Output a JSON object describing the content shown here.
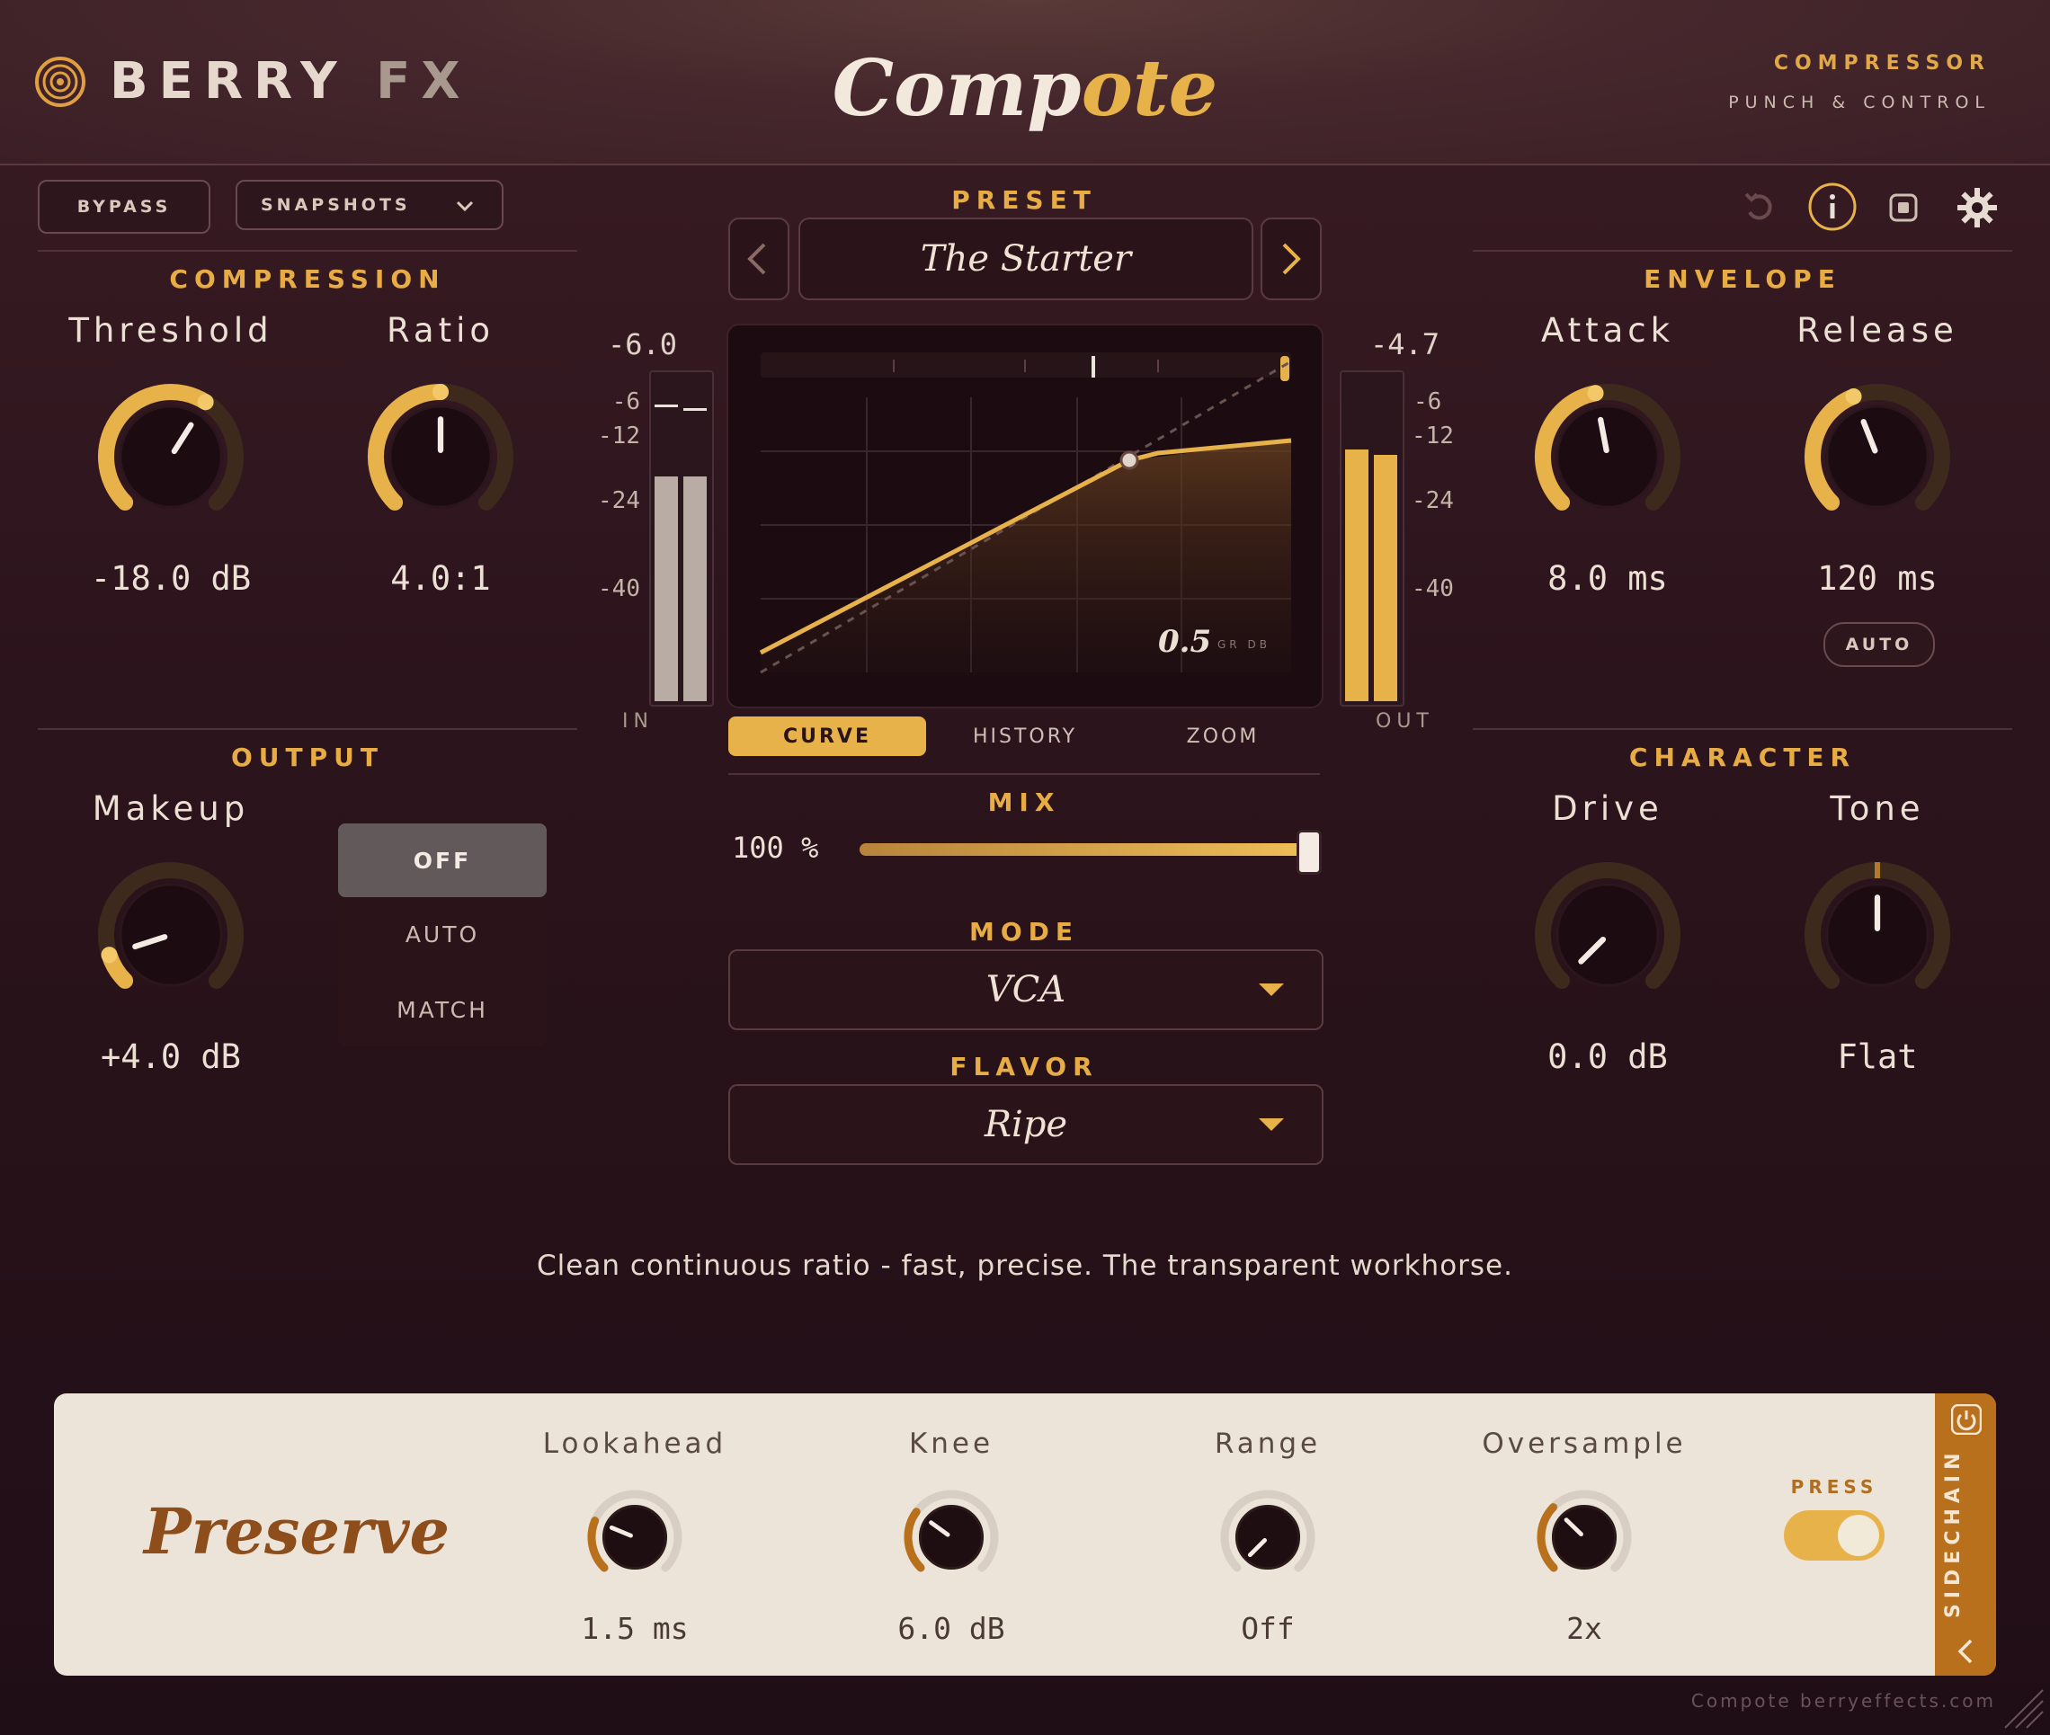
{
  "header": {
    "brand_main": "BERRY",
    "brand_sub": "FX",
    "title_a": "Comp",
    "title_b": "ote",
    "tagline_top": "COMPRESSOR",
    "tagline_bottom": "PUNCH & CONTROL"
  },
  "toolbar": {
    "bypass": "BYPASS",
    "snapshots": "SNAPSHOTS",
    "icons": [
      "undo-icon",
      "info-icon",
      "stop-icon",
      "gear-icon"
    ]
  },
  "preset": {
    "label": "PRESET",
    "name": "The Starter"
  },
  "compression": {
    "title": "COMPRESSION",
    "threshold": {
      "label": "Threshold",
      "value": "-18.0 dB",
      "level": 0.62
    },
    "ratio": {
      "label": "Ratio",
      "value": "4.0:1",
      "level": 0.5
    }
  },
  "output": {
    "title": "OUTPUT",
    "makeup": {
      "label": "Makeup",
      "value": "+4.0 dB",
      "level": 0.1
    },
    "modes": [
      "OFF",
      "AUTO",
      "MATCH"
    ],
    "selected_mode": "OFF"
  },
  "meters": {
    "in_readout": "-6.0",
    "out_readout": "-4.7",
    "in_label": "IN",
    "out_label": "OUT",
    "scale": [
      "-6",
      "-12",
      "-24",
      "-40"
    ]
  },
  "graph": {
    "gr_value": "0.5",
    "gr_unit": "GR DB"
  },
  "tabs": [
    "CURVE",
    "HISTORY",
    "ZOOM"
  ],
  "mix": {
    "label": "MIX",
    "value": "100 %",
    "level": 1.0
  },
  "mode": {
    "label": "MODE",
    "value": "VCA"
  },
  "flavor": {
    "label": "FLAVOR",
    "value": "Ripe"
  },
  "envelope": {
    "title": "ENVELOPE",
    "attack": {
      "label": "Attack",
      "value": "8.0 ms",
      "level": 0.46
    },
    "release": {
      "label": "Release",
      "value": "120 ms",
      "level": 0.42
    },
    "auto": "AUTO"
  },
  "character": {
    "title": "CHARACTER",
    "drive": {
      "label": "Drive",
      "value": "0.0 dB",
      "level": 0.0
    },
    "tone": {
      "label": "Tone",
      "value": "Flat",
      "level": 0.5
    }
  },
  "description": "Clean continuous ratio - fast, precise. The transparent workhorse.",
  "bottom": {
    "title": "Preserve",
    "lookahead": {
      "label": "Lookahead",
      "value": "1.5 ms",
      "level": 0.25
    },
    "knee": {
      "label": "Knee",
      "value": "6.0 dB",
      "level": 0.3
    },
    "range": {
      "label": "Range",
      "value": "Off",
      "level": 0.0
    },
    "oversample": {
      "label": "Oversample",
      "value": "2x",
      "level": 0.33
    },
    "press_label": "PRESS",
    "sidechain": "SIDECHAIN"
  },
  "footer": "Compote  berryeffects.com",
  "colors": {
    "accent": "#e8b24a",
    "bg": "#2c141c",
    "panel": "#ece4d8",
    "orange": "#b8701c"
  }
}
